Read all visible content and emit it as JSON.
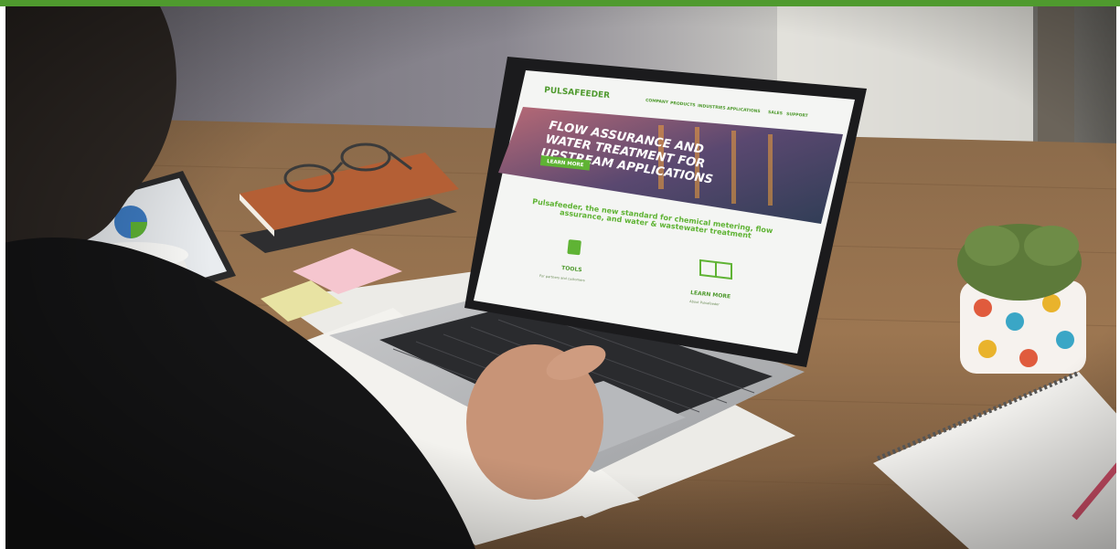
{
  "brand_bar_color": "#4f9a2e",
  "accent_green": "#5fb334",
  "laptop_site": {
    "logo_text": "PULSAFEEDER",
    "nav": [
      "COMPANY",
      "PRODUCTS",
      "INDUSTRIES",
      "APPLICATIONS",
      "SALES",
      "SUPPORT"
    ],
    "hero": {
      "headline_lines": [
        "FLOW ASSURANCE AND",
        "WATER TREATMENT FOR",
        "UPSTREAM APPLICATIONS"
      ],
      "cta": "LEARN MORE"
    },
    "tagline_lines": [
      "Pulsafeeder, the new standard for chemical metering, flow",
      "assurance, and water & wastewater treatment"
    ],
    "tiles": [
      {
        "title": "TOOLS",
        "caption": "For partners and customers",
        "icon": "calculator-icon"
      },
      {
        "title": "LEARN MORE",
        "caption": "About Pulsafeeder",
        "icon": "book-icon"
      }
    ]
  }
}
